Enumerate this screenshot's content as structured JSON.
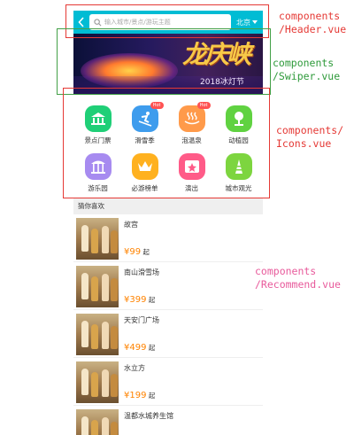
{
  "header": {
    "search_placeholder": "输入城市/景点/游玩主题",
    "city": "北京"
  },
  "swiper": {
    "title": "龙庆峡",
    "subtitle": "2018冰灯节"
  },
  "icons": [
    {
      "label": "景点门票",
      "icon": "ticket-icon",
      "color": "#1fcf77",
      "hot": ""
    },
    {
      "label": "滑雪季",
      "icon": "ski-icon",
      "color": "#3e9ced",
      "hot": "Hot"
    },
    {
      "label": "泡温泉",
      "icon": "hot-spring-icon",
      "color": "#ff9a4a",
      "hot": "Hot"
    },
    {
      "label": "动植园",
      "icon": "plant-icon",
      "color": "#60d241",
      "hot": ""
    },
    {
      "label": "游乐园",
      "icon": "carousel-icon",
      "color": "#a78bf0",
      "hot": ""
    },
    {
      "label": "必游榜单",
      "icon": "crown-icon",
      "color": "#ffb11f",
      "hot": ""
    },
    {
      "label": "演出",
      "icon": "stage-icon",
      "color": "#ff5b88",
      "hot": ""
    },
    {
      "label": "城市观光",
      "icon": "city-tour-icon",
      "color": "#7dd53f",
      "hot": ""
    }
  ],
  "recommend": {
    "heading": "猜你喜欢",
    "items": [
      {
        "name": "故宫",
        "currency": "¥",
        "price": "99",
        "suffix": "起"
      },
      {
        "name": "南山滑雪场",
        "currency": "¥",
        "price": "399",
        "suffix": "起"
      },
      {
        "name": "天安门广场",
        "currency": "¥",
        "price": "499",
        "suffix": "起"
      },
      {
        "name": "水立方",
        "currency": "¥",
        "price": "199",
        "suffix": "起"
      },
      {
        "name": "温都水城养生馆",
        "currency": "",
        "price": "",
        "suffix": ""
      }
    ]
  },
  "annotations": {
    "header_note": "components\n/Header.vue",
    "swiper_note": "components\n/Swiper.vue",
    "icons_note": "components/\nIcons.vue",
    "recommend_note": "components\n/Recommend.vue"
  },
  "colors": {
    "header_bg": "#00bcd4",
    "price": "#ff8300",
    "header_box": "#e53935",
    "swiper_box": "#43a047",
    "icons_box": "#e53935"
  }
}
